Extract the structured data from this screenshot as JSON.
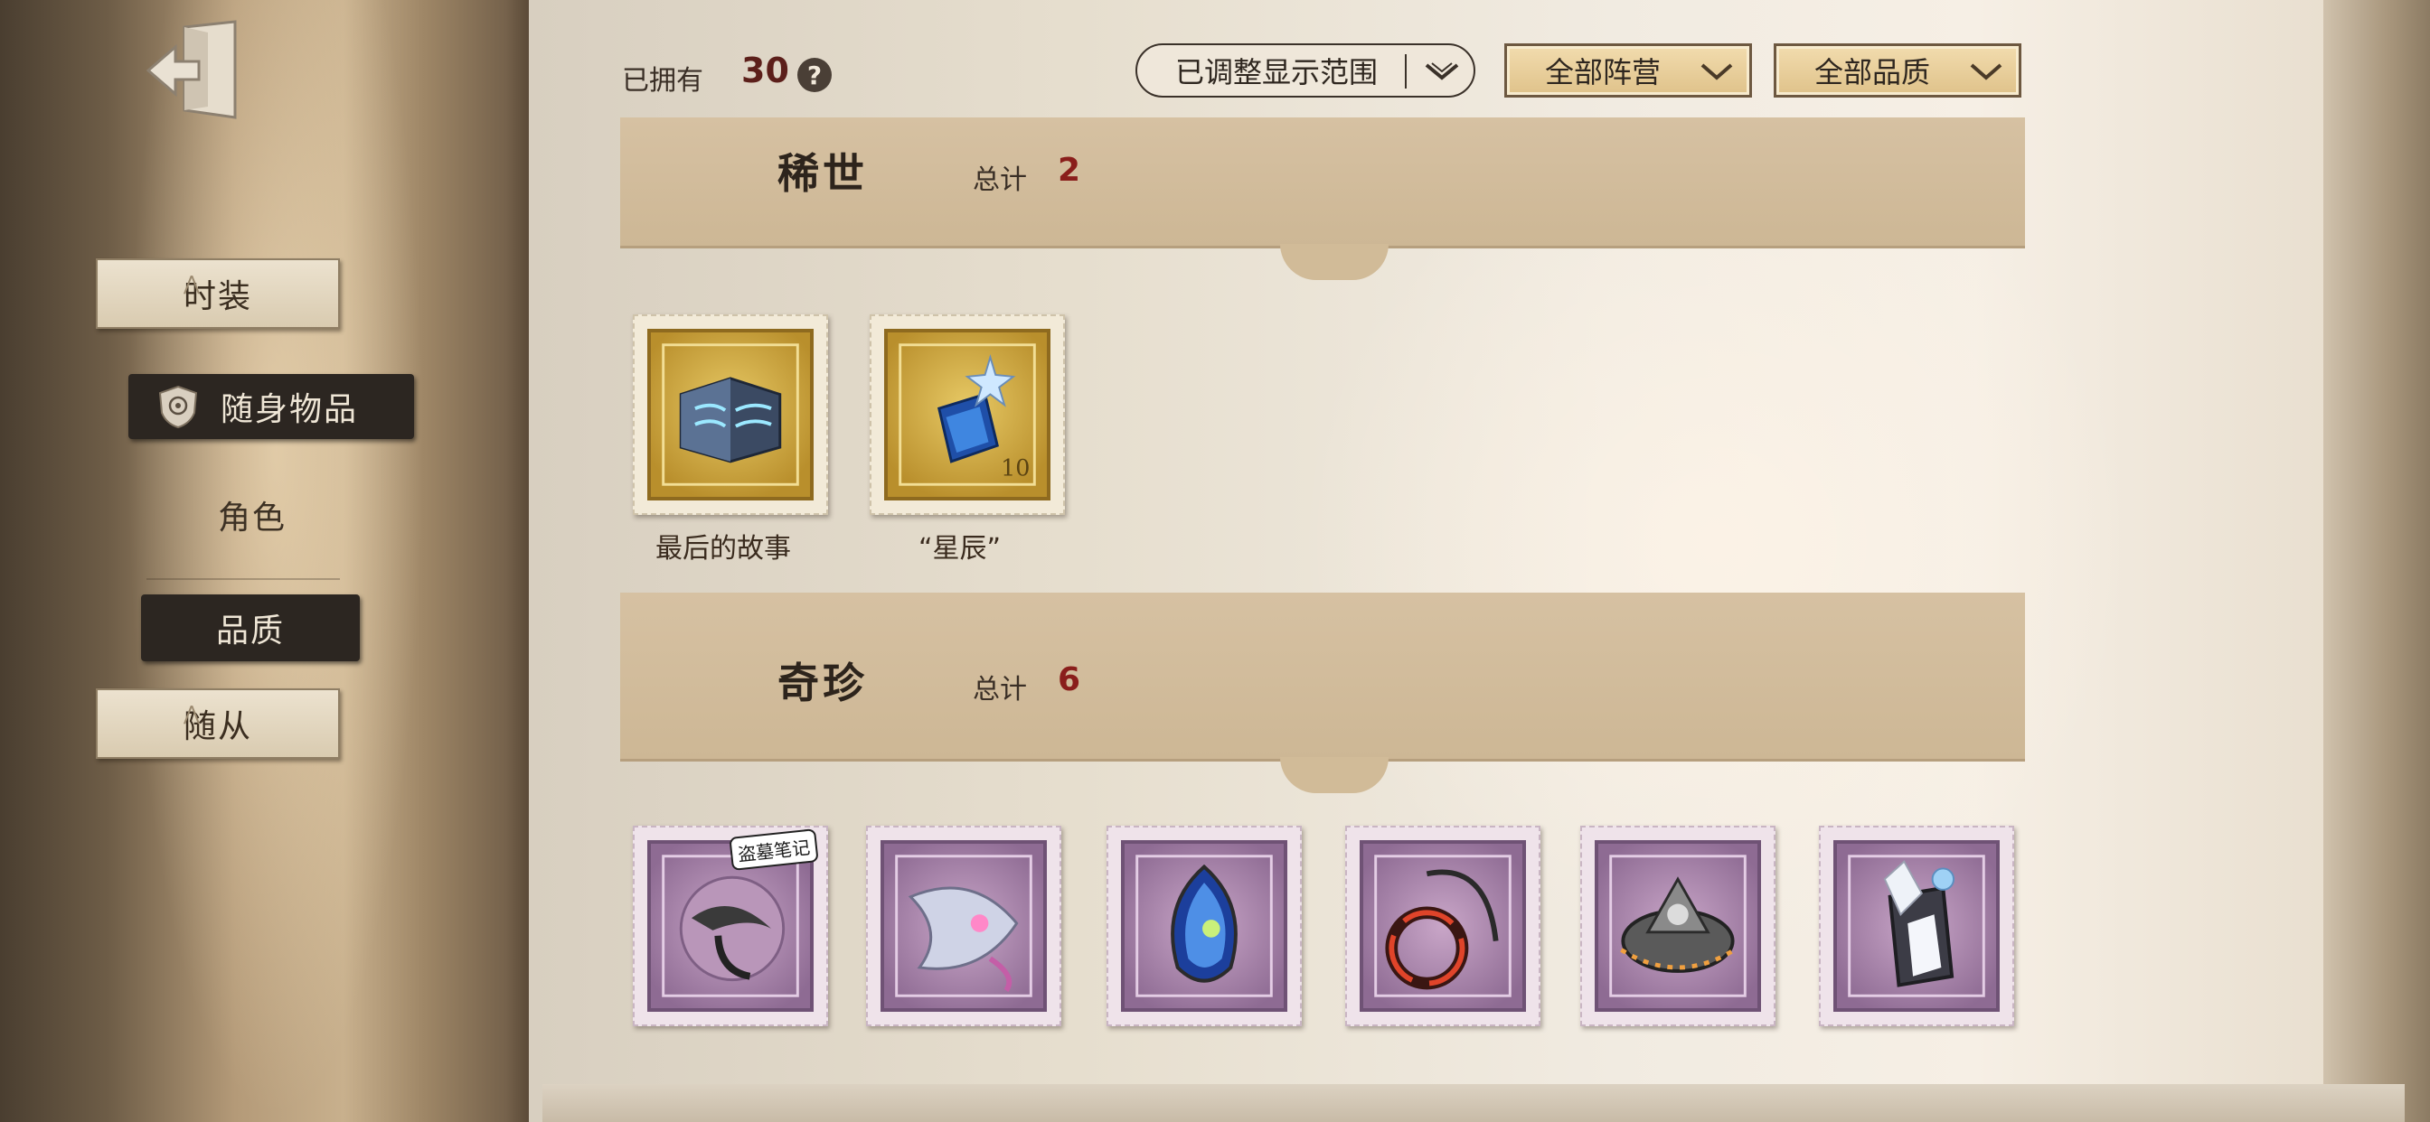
{
  "sidebar": {
    "exit_icon": "exit-door-icon",
    "items": [
      {
        "label": "时装",
        "state": "paper"
      },
      {
        "label": "随身物品",
        "state": "selected",
        "icon": "emblem-icon"
      },
      {
        "label": "角色",
        "state": "plain"
      },
      {
        "label": "品质",
        "state": "dark"
      },
      {
        "label": "随从",
        "state": "paper"
      }
    ]
  },
  "header": {
    "owned_label": "已拥有",
    "owned_count": "30",
    "help_icon": "?",
    "range_filter": "已调整显示范围",
    "camp_filter": "全部阵营",
    "quality_filter": "全部品质"
  },
  "sections": [
    {
      "title": "稀世",
      "total_label": "总计",
      "total": "2",
      "items": [
        {
          "name": "最后的故事",
          "icon": "book-pages-icon",
          "frame": "gold"
        },
        {
          "name": "“星辰”",
          "icon": "star-bottle-icon",
          "frame": "gold"
        }
      ]
    },
    {
      "title": "奇珍",
      "total_label": "总计",
      "total": "6",
      "items": [
        {
          "icon": "fish-pendant-icon",
          "frame": "purple",
          "badge": "盗墓笔记"
        },
        {
          "icon": "angelfish-icon",
          "frame": "purple"
        },
        {
          "icon": "blue-gem-icon",
          "frame": "purple"
        },
        {
          "icon": "red-ring-icon",
          "frame": "purple"
        },
        {
          "icon": "mechanical-crown-icon",
          "frame": "purple"
        },
        {
          "icon": "crystal-lantern-icon",
          "frame": "purple"
        }
      ]
    }
  ],
  "colors": {
    "accent_red": "#8a1e1b",
    "gold_frame": "#b98f2c",
    "purple_frame": "#8e6b93",
    "dark_button": "#2c2621"
  }
}
